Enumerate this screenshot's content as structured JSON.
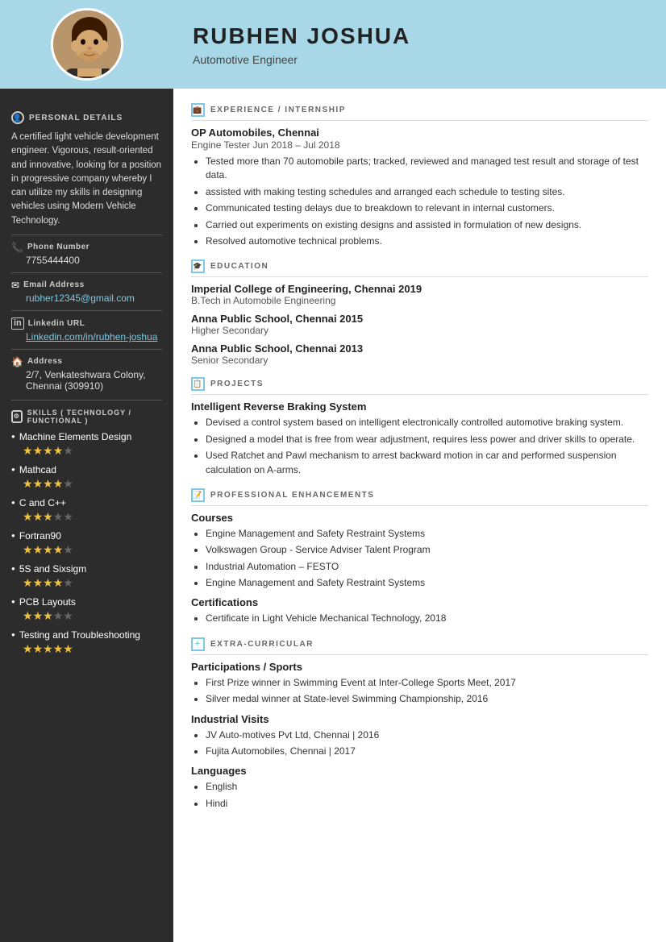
{
  "header": {
    "name": "RUBHEN JOSHUA",
    "title": "Automotive Engineer"
  },
  "sidebar": {
    "section_personal": "PERSONAL DETAILS",
    "bio": "A certified light vehicle development engineer. Vigorous, result-oriented and innovative, looking for a position in progressive company whereby I can utilize my skills in designing vehicles using Modern Vehicle Technology.",
    "phone_label": "Phone Number",
    "phone": "7755444400",
    "email_label": "Email Address",
    "email": "rubher12345@gmail.com",
    "linkedin_label": "Linkedin URL",
    "linkedin": "Linkedin.com/in/rubhen-joshua",
    "address_label": "Address",
    "address": "2/7, Venkateshwara Colony, Chennai (309910)",
    "skills_label": "SKILLS ( TECHNOLOGY / FUNCTIONAL )",
    "skills": [
      {
        "name": "Machine Elements Design",
        "stars": 5,
        "filled": 4
      },
      {
        "name": "Mathcad",
        "stars": 5,
        "filled": 4
      },
      {
        "name": "C and C++",
        "stars": 5,
        "filled": 3
      },
      {
        "name": "Fortran90",
        "stars": 5,
        "filled": 4
      },
      {
        "name": "5S and Sixsigm",
        "stars": 5,
        "filled": 4
      },
      {
        "name": "PCB Layouts",
        "stars": 5,
        "filled": 3
      },
      {
        "name": "Testing and Troubleshooting",
        "stars": 5,
        "filled": 5
      }
    ]
  },
  "sections": {
    "experience": {
      "label": "EXPERIENCE / INTERNSHIP",
      "company": "OP Automobiles, Chennai",
      "role": "Engine Tester Jun 2018 – Jul 2018",
      "bullets": [
        "Tested more than 70 automobile parts; tracked, reviewed and managed test result and storage of test data.",
        "assisted with making testing schedules and arranged each schedule to testing sites.",
        "Communicated testing delays due to breakdown to relevant in internal customers.",
        "Carried out experiments on existing designs and assisted in formulation of new designs.",
        "Resolved automotive technical problems."
      ]
    },
    "education": {
      "label": "EDUCATION",
      "entries": [
        {
          "school": "Imperial College of Engineering, Chennai 2019",
          "degree": "B.Tech in Automobile Engineering"
        },
        {
          "school": "Anna Public School, Chennai 2015",
          "degree": "Higher Secondary"
        },
        {
          "school": "Anna Public School, Chennai 2013",
          "degree": "Senior Secondary"
        }
      ]
    },
    "projects": {
      "label": "PROJECTS",
      "title": "Intelligent Reverse Braking System",
      "bullets": [
        "Devised a control system based on intelligent electronically controlled automotive braking system.",
        "Designed a model that is free from wear adjustment, requires less power and driver skills to operate.",
        "Used Ratchet and Pawl mechanism to arrest backward motion in car and performed suspension calculation on A-arms."
      ]
    },
    "enhancements": {
      "label": "PROFESSIONAL ENHANCEMENTS",
      "courses_heading": "Courses",
      "courses": [
        "Engine Management and Safety Restraint Systems",
        "Volkswagen Group - Service Adviser Talent Program",
        "Industrial Automation – FESTO",
        "Engine Management and Safety Restraint Systems"
      ],
      "cert_heading": "Certifications",
      "certs": [
        "Certificate in Light Vehicle Mechanical Technology, 2018"
      ]
    },
    "extracurricular": {
      "label": "EXTRA-CURRICULAR",
      "sports_heading": "Participations / Sports",
      "sports": [
        "First Prize winner in Swimming Event at Inter-College Sports Meet, 2017",
        "Silver medal winner at State-level Swimming Championship, 2016"
      ],
      "industrial_heading": "Industrial Visits",
      "industrial": [
        "JV Auto-motives Pvt Ltd, Chennai | 2016",
        "Fujita Automobiles, Chennai | 2017"
      ],
      "lang_heading": "Languages",
      "languages": [
        "English",
        "Hindi"
      ]
    }
  }
}
